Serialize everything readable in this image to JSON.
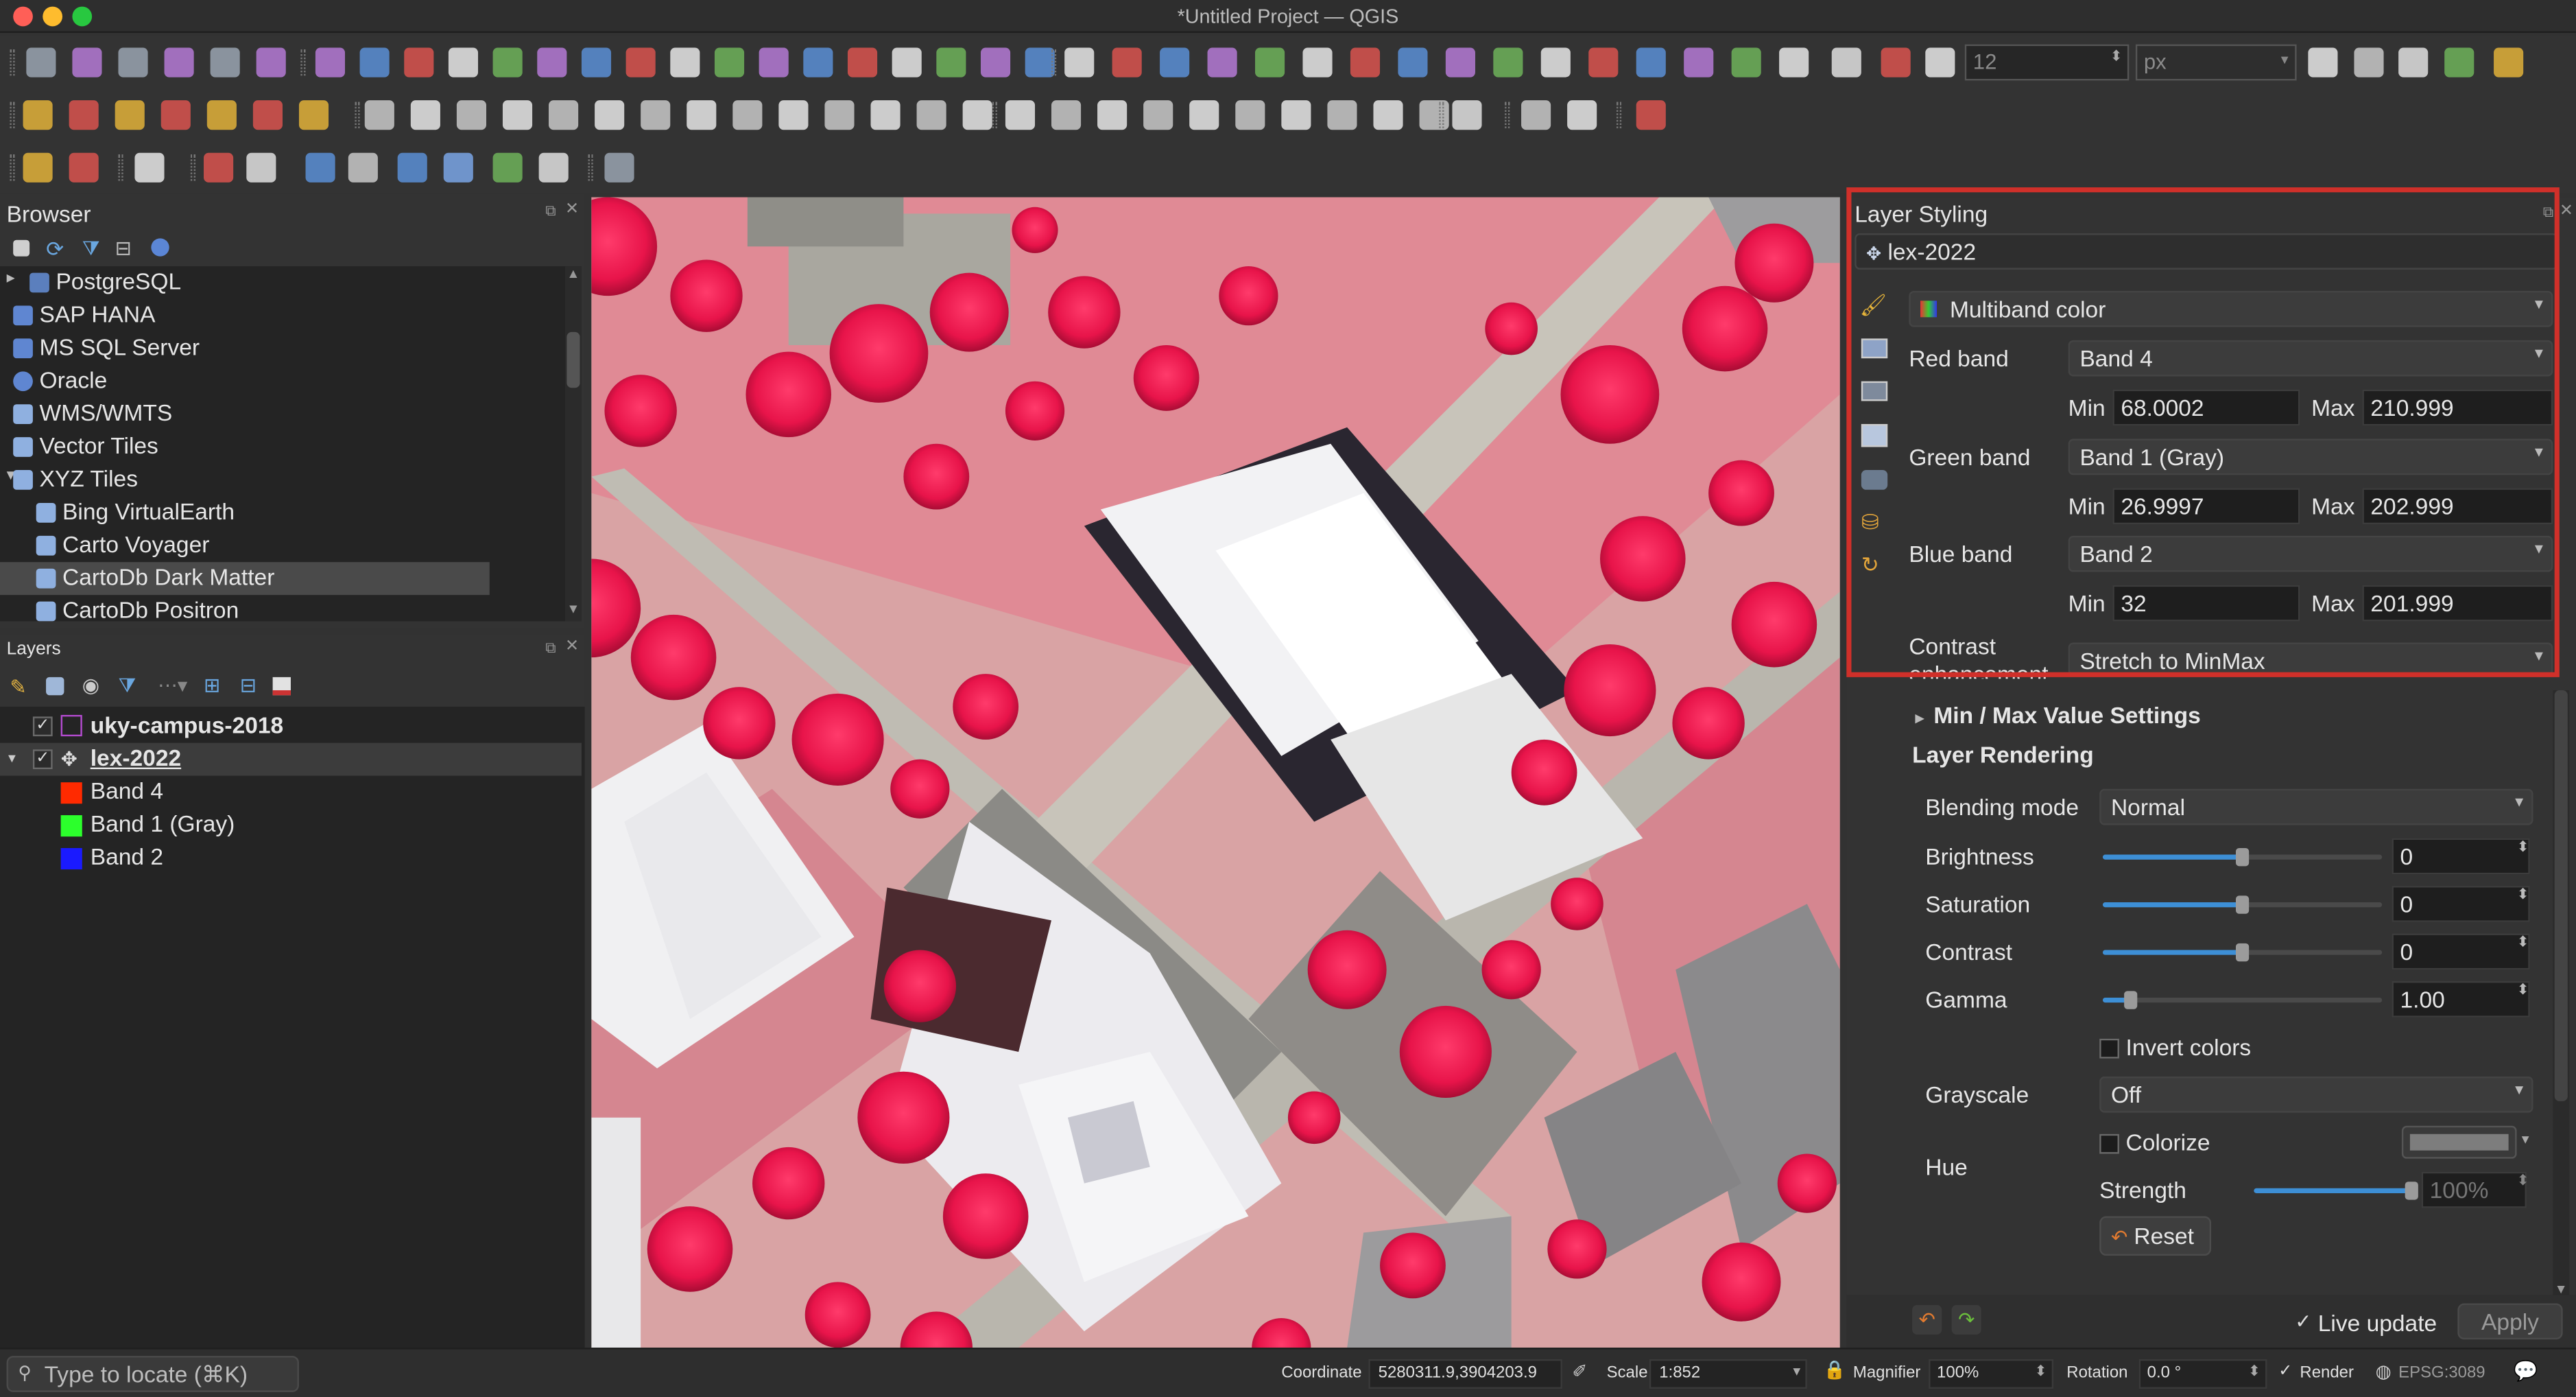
{
  "window": {
    "title": "*Untitled Project — QGIS"
  },
  "toolbar": {
    "snap_tolerance": "12",
    "snap_units": "px"
  },
  "browser": {
    "title": "Browser",
    "items": [
      {
        "label": "PostgreSQL",
        "icon": "postgresql-icon"
      },
      {
        "label": "SAP HANA",
        "icon": "sap-hana-icon"
      },
      {
        "label": "MS SQL Server",
        "icon": "mssql-icon"
      },
      {
        "label": "Oracle",
        "icon": "oracle-icon"
      },
      {
        "label": "WMS/WMTS",
        "icon": "wms-icon"
      },
      {
        "label": "Vector Tiles",
        "icon": "vector-tiles-icon"
      },
      {
        "label": "XYZ Tiles",
        "icon": "xyz-tiles-icon"
      },
      {
        "label": "Bing VirtualEarth",
        "icon": "xyz-tile-icon"
      },
      {
        "label": "Carto Voyager",
        "icon": "xyz-tile-icon"
      },
      {
        "label": "CartoDb Dark Matter",
        "icon": "xyz-tile-icon"
      },
      {
        "label": "CartoDb Positron",
        "icon": "xyz-tile-icon"
      }
    ]
  },
  "layers": {
    "title": "Layers",
    "items": [
      {
        "label": "uky-campus-2018"
      },
      {
        "label": "lex-2022"
      },
      {
        "label": "Band 4",
        "color": "#ff2a00"
      },
      {
        "label": "Band 1 (Gray)",
        "color": "#2cff2c"
      },
      {
        "label": "Band 2",
        "color": "#1a1aff"
      }
    ]
  },
  "styling": {
    "title": "Layer Styling",
    "layer": "lex-2022",
    "renderer": "Multiband color",
    "red_label": "Red band",
    "red_band": "Band 4",
    "red_min_label": "Min",
    "red_min": "68.0002",
    "red_max_label": "Max",
    "red_max": "210.999",
    "green_label": "Green band",
    "green_band": "Band 1 (Gray)",
    "green_min_label": "Min",
    "green_min": "26.9997",
    "green_max_label": "Max",
    "green_max": "202.999",
    "blue_label": "Blue band",
    "blue_band": "Band 2",
    "blue_min_label": "Min",
    "blue_min": "32",
    "blue_max_label": "Max",
    "blue_max": "201.999",
    "contrast_label": "Contrast enhancement",
    "contrast_value": "Stretch to MinMax",
    "minmax_label": "Min / Max Value Settings",
    "rendering_label": "Layer Rendering",
    "blending_label": "Blending mode",
    "blending_value": "Normal",
    "brightness_label": "Brightness",
    "brightness_value": "0",
    "brightness_level": 0.5,
    "saturation_label": "Saturation",
    "saturation_value": "0",
    "saturation_level": 0.5,
    "contrast2_label": "Contrast",
    "contrast2_value": "0",
    "contrast2_level": 0.5,
    "gamma_label": "Gamma",
    "gamma_value": "1.00",
    "gamma_level": 0.1,
    "invert_label": "Invert colors",
    "grayscale_label": "Grayscale",
    "grayscale_value": "Off",
    "hue_label": "Hue",
    "colorize_label": "Colorize",
    "strength_label": "Strength",
    "strength_value": "100%",
    "strength_level": 1.0,
    "reset_label": "Reset",
    "live_update_label": "Live update",
    "apply_label": "Apply",
    "highlight_color": "#d0302a"
  },
  "status": {
    "locate_placeholder": "Type to locate (⌘K)",
    "coordinate_label": "Coordinate",
    "coordinate_value": "5280311.9,3904203.9",
    "scale_label": "Scale",
    "scale_value": "1:852",
    "magnifier_label": "Magnifier",
    "magnifier_value": "100%",
    "rotation_label": "Rotation",
    "rotation_value": "0.0 °",
    "render_label": "Render",
    "crs": "EPSG:3089"
  }
}
